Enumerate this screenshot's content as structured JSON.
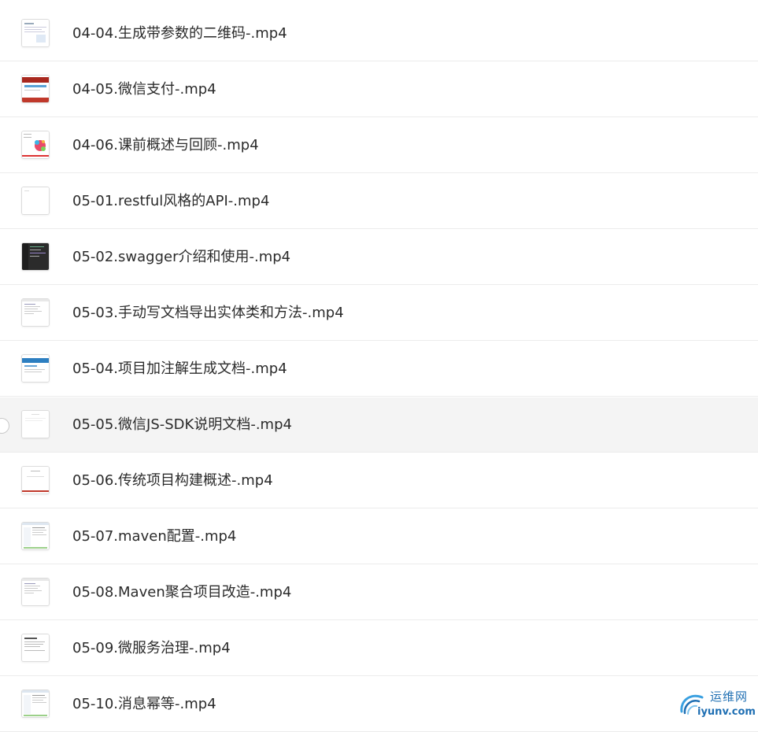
{
  "files": [
    {
      "name": "04-04.生成带参数的二维码-.mp4",
      "thumb": "doc-blue"
    },
    {
      "name": "04-05.微信支付-.mp4",
      "thumb": "red-banner"
    },
    {
      "name": "04-06.课前概述与回顾-.mp4",
      "thumb": "colorful-diagram"
    },
    {
      "name": "05-01.restful风格的API-.mp4",
      "thumb": "blank-page"
    },
    {
      "name": "05-02.swagger介绍和使用-.mp4",
      "thumb": "dark-ide"
    },
    {
      "name": "05-03.手动写文档导出实体类和方法-.mp4",
      "thumb": "code-page"
    },
    {
      "name": "05-04.项目加注解生成文档-.mp4",
      "thumb": "blue-header"
    },
    {
      "name": "05-05.微信JS-SDK说明文档-.mp4",
      "thumb": "plain-doc"
    },
    {
      "name": "05-06.传统项目构建概述-.mp4",
      "thumb": "slide-red-line"
    },
    {
      "name": "05-07.maven配置-.mp4",
      "thumb": "explorer"
    },
    {
      "name": "05-08.Maven聚合项目改造-.mp4",
      "thumb": "code-page"
    },
    {
      "name": "05-09.微服务治理-.mp4",
      "thumb": "text-page"
    },
    {
      "name": "05-10.消息幂等-.mp4",
      "thumb": "explorer"
    }
  ],
  "hovered_index": 7,
  "watermark": {
    "cn": "运维网",
    "en": "iyunv.com"
  },
  "colors": {
    "row_border": "#ececec",
    "hover_bg": "#f4f4f4",
    "text": "#2b2b2b",
    "watermark": "#1f6fb3"
  }
}
